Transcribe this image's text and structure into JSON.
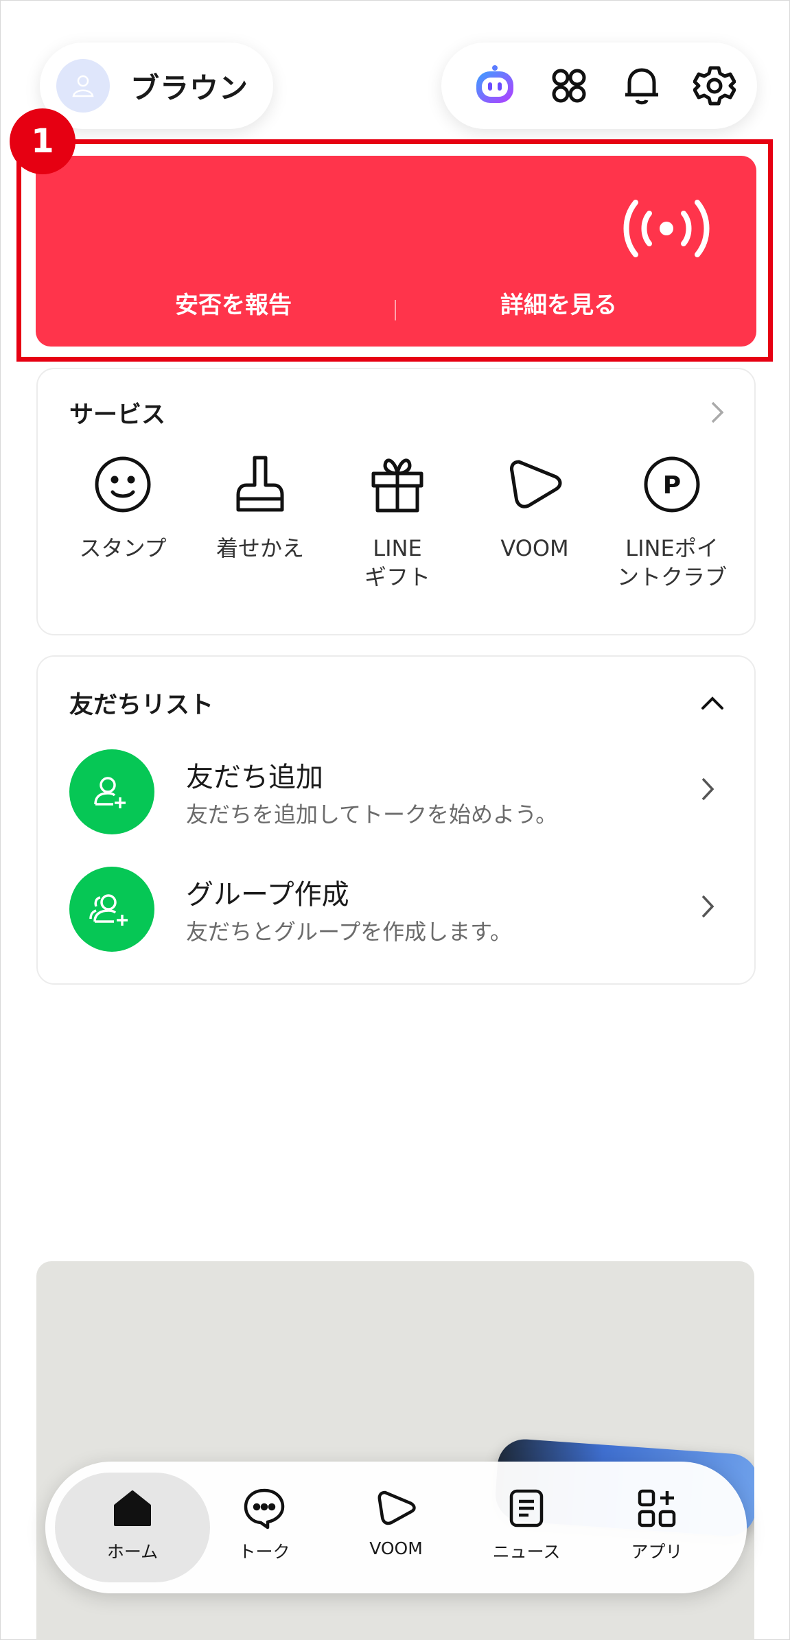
{
  "header": {
    "profile_name": "ブラウン",
    "icons": [
      "ai-assistant-icon",
      "services-grid-icon",
      "notification-bell-icon",
      "settings-gear-icon"
    ]
  },
  "safety_banner": {
    "step_number": "1",
    "report_label": "安否を報告",
    "details_label": "詳細を見る",
    "color": "#ff344b",
    "highlight_color": "#e60012"
  },
  "services": {
    "title": "サービス",
    "items": [
      {
        "label": "スタンプ",
        "icon": "smiley-icon"
      },
      {
        "label": "着せかえ",
        "icon": "paint-brush-icon"
      },
      {
        "label": "LINE\nギフト",
        "icon": "gift-icon"
      },
      {
        "label": "VOOM",
        "icon": "voom-play-icon"
      },
      {
        "label": "LINEポイ\nントクラブ",
        "icon": "points-p-icon"
      }
    ]
  },
  "friends": {
    "title": "友だちリスト",
    "rows": [
      {
        "title": "友だち追加",
        "subtitle": "友だちを追加してトークを始めよう。",
        "icon": "add-friend-icon"
      },
      {
        "title": "グループ作成",
        "subtitle": "友だちとグループを作成します。",
        "icon": "create-group-icon"
      }
    ],
    "accent": "#06c755"
  },
  "bottom_nav": {
    "items": [
      {
        "label": "ホーム",
        "icon": "home-icon",
        "active": true
      },
      {
        "label": "トーク",
        "icon": "chat-bubble-icon"
      },
      {
        "label": "VOOM",
        "icon": "voom-icon"
      },
      {
        "label": "ニュース",
        "icon": "news-icon"
      },
      {
        "label": "アプリ",
        "icon": "apps-icon"
      }
    ]
  }
}
